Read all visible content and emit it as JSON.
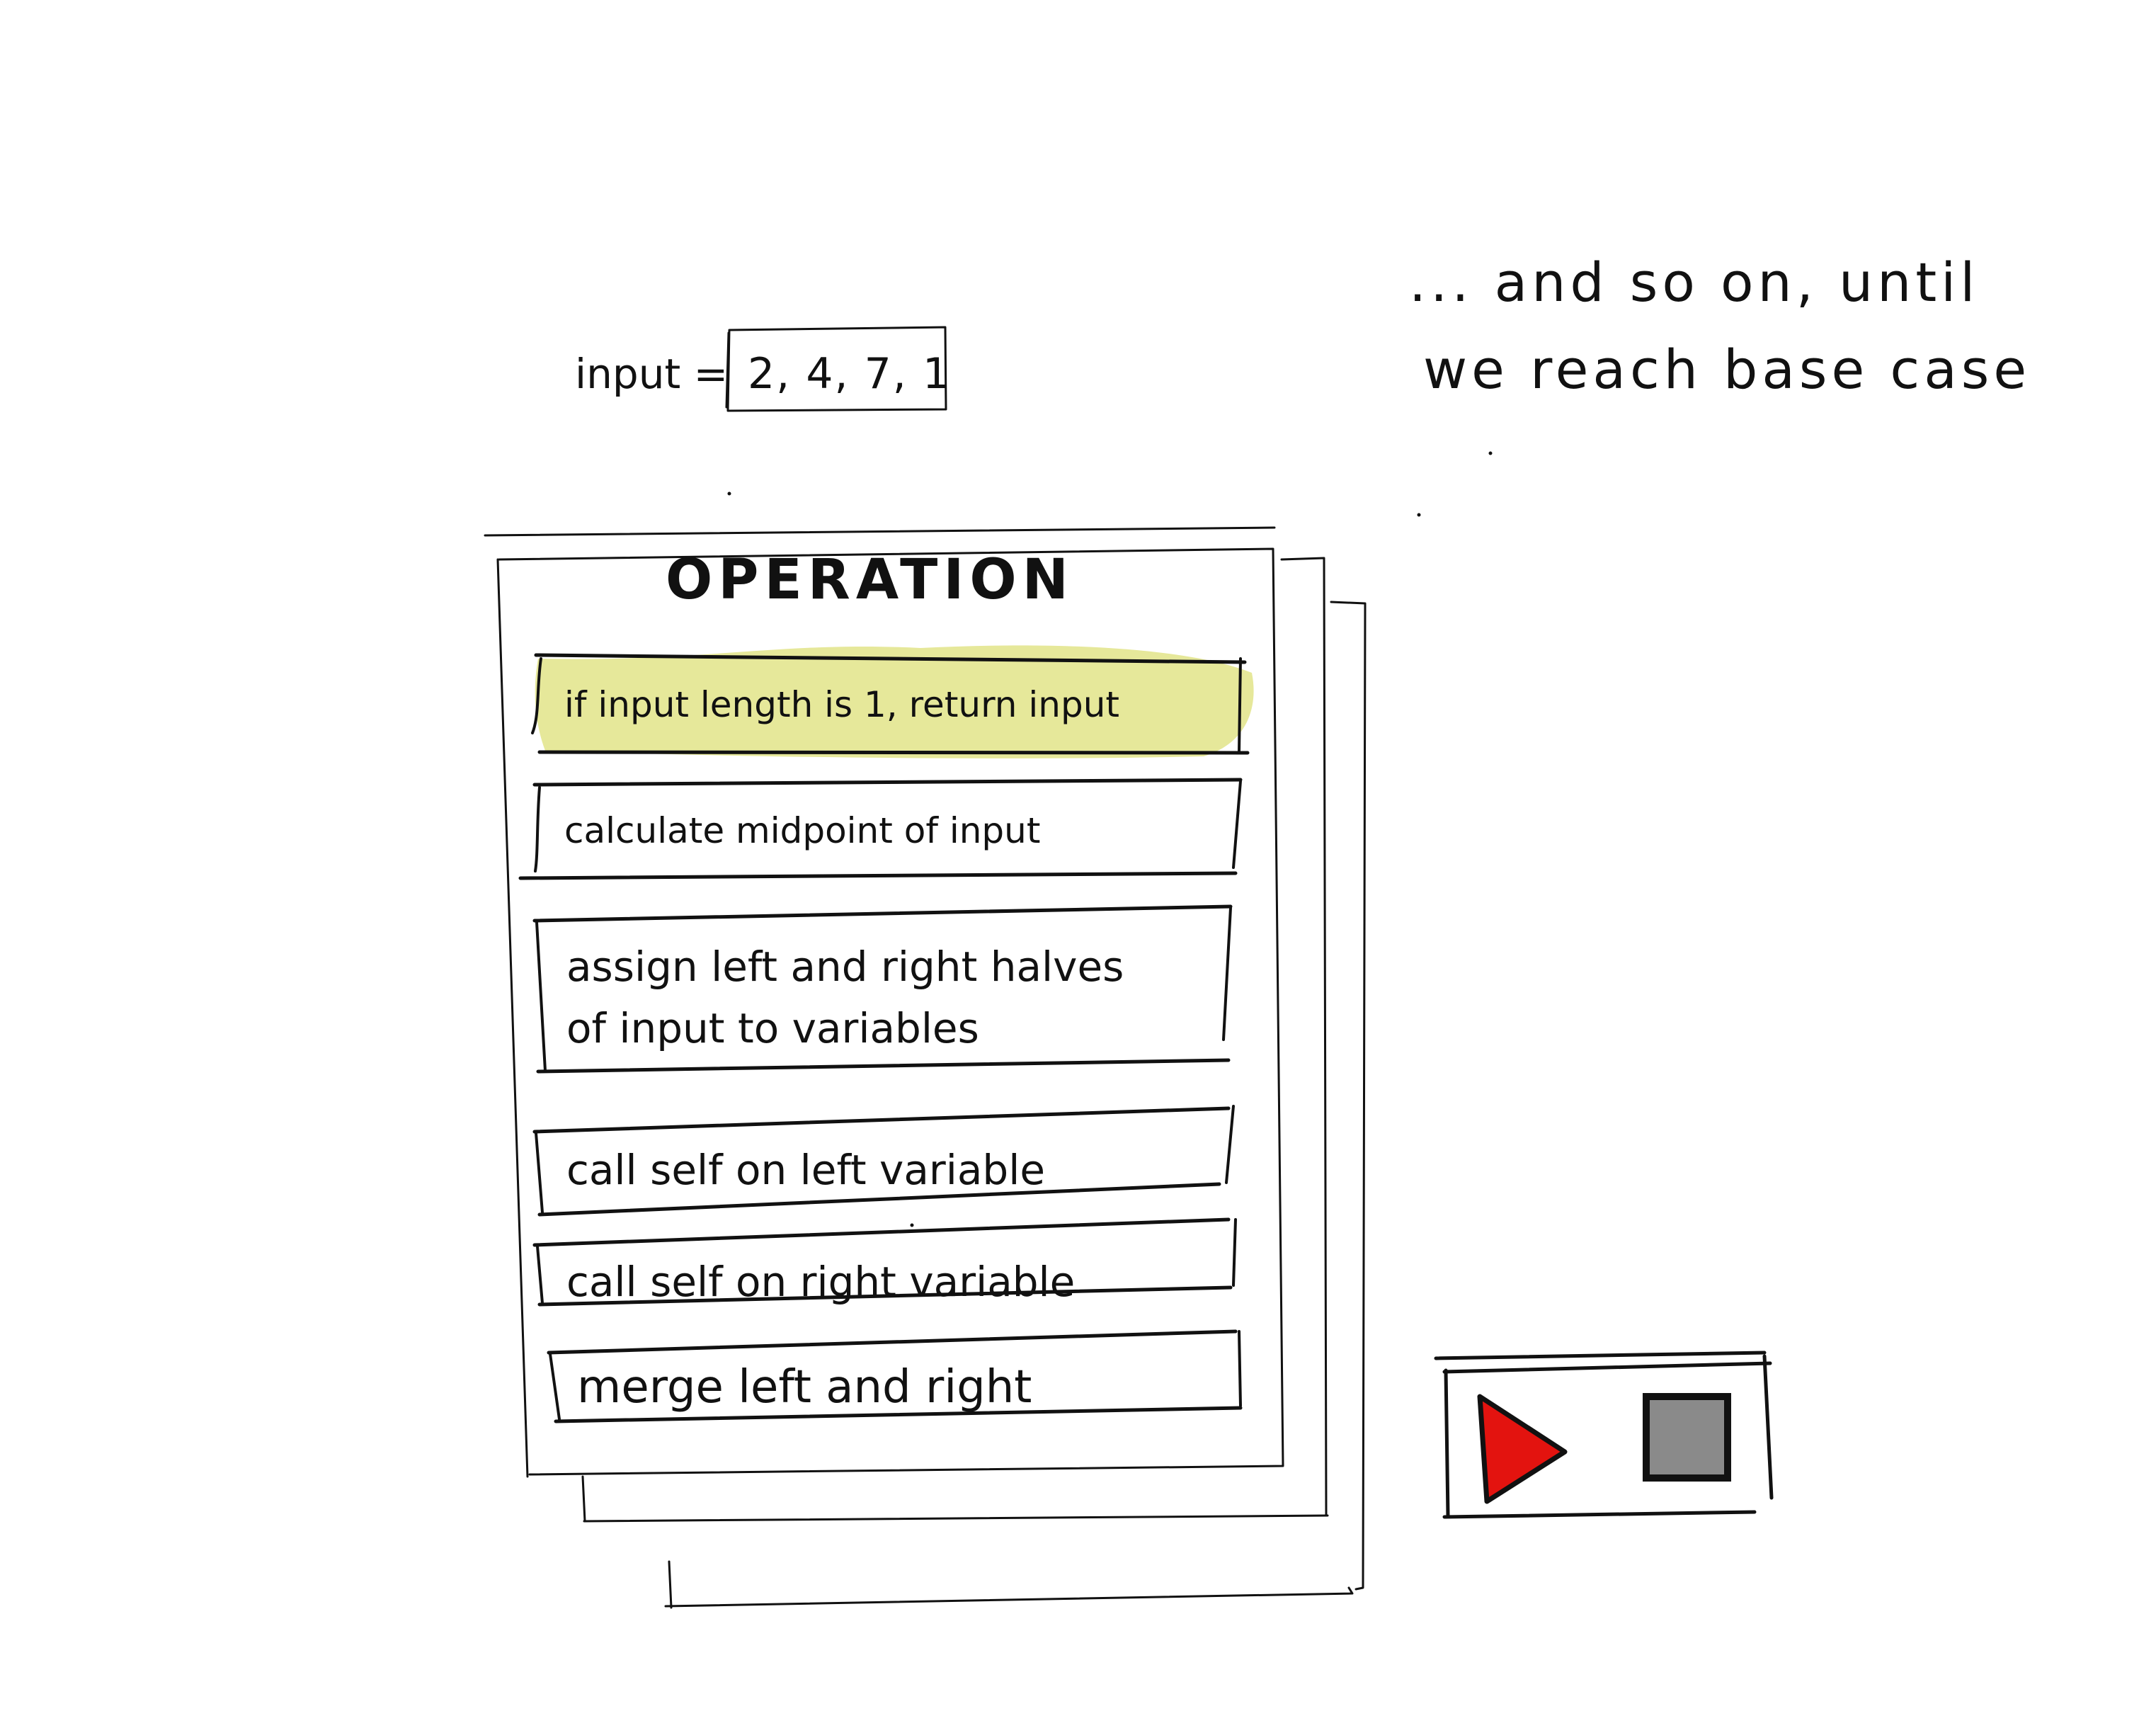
{
  "annotation": {
    "line1": "... and so on, until",
    "line2": "we reach base case"
  },
  "input": {
    "label": "input =",
    "value": "2, 4, 7, 1"
  },
  "operation_panel": {
    "title": "OPERATION",
    "steps": [
      {
        "text": "if input length is 1, return input",
        "highlighted": true
      },
      {
        "text": "calculate midpoint of input",
        "highlighted": false
      },
      {
        "text": "assign left and right halves",
        "text_line2": "of input to variables",
        "highlighted": false
      },
      {
        "text": "call self on left variable",
        "highlighted": false
      },
      {
        "text": "call self on right variable",
        "highlighted": false
      },
      {
        "text": "merge left and right",
        "highlighted": false
      }
    ]
  },
  "playback_controls": {
    "play_icon": "play-icon",
    "stop_icon": "stop-icon"
  },
  "colors": {
    "ink": "#111111",
    "highlight": "#e6e89a",
    "play": "#e3130f",
    "stop": "#8a8a8a"
  }
}
